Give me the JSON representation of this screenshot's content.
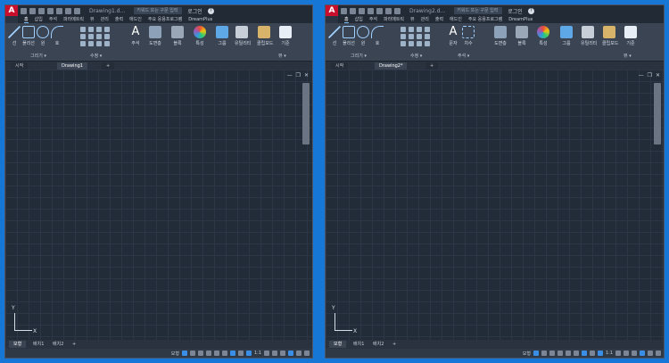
{
  "windows": [
    {
      "id": "left",
      "doc_title": "Drawing1.d...",
      "search_placeholder": "키워드 또는 구문 입력",
      "login": "로그인",
      "help": "?",
      "menu": [
        "홈",
        "삽입",
        "주석",
        "파라메트릭",
        "뷰",
        "관리",
        "출력",
        "애드인",
        "주요 응용프로그램",
        "DreamPlus"
      ],
      "ribbon_tools": [
        {
          "label": "선",
          "icon": "line-icon"
        },
        {
          "label": "폴리선",
          "icon": "polyline-icon"
        },
        {
          "label": "원",
          "icon": "circle-icon"
        },
        {
          "label": "호",
          "icon": "arc-icon"
        },
        {
          "label": "주석",
          "icon": "text-icon"
        },
        {
          "label": "도면층",
          "icon": "layers-icon"
        },
        {
          "label": "블록",
          "icon": "block-icon"
        },
        {
          "label": "특성",
          "icon": "properties-icon"
        },
        {
          "label": "그룹",
          "icon": "group-icon"
        },
        {
          "label": "유틸리티",
          "icon": "calculator-icon"
        },
        {
          "label": "클립보드",
          "icon": "clipboard-icon"
        },
        {
          "label": "기준",
          "icon": "base-icon"
        }
      ],
      "panel_labels": [
        "그리기 ▾",
        "수정 ▾",
        "뷰 ▾"
      ],
      "file_tabs": [
        "시작",
        "Drawing1",
        "+"
      ],
      "viewport_controls": "— ❐ ✕",
      "layout_tabs": [
        "모형",
        "배치1",
        "배치2",
        "+"
      ],
      "status_text": [
        "모형",
        "1:1"
      ]
    },
    {
      "id": "right",
      "doc_title": "Drawing2.d...",
      "search_placeholder": "키워드 또는 구문 입력",
      "login": "로그인",
      "help": "?",
      "menu": [
        "홈",
        "삽입",
        "주석",
        "파라메트릭",
        "뷰",
        "관리",
        "출력",
        "애드인",
        "주요 응용프로그램",
        "DreamPlus"
      ],
      "ribbon_tools": [
        {
          "label": "선",
          "icon": "line-icon"
        },
        {
          "label": "폴리선",
          "icon": "polyline-icon"
        },
        {
          "label": "원",
          "icon": "circle-icon"
        },
        {
          "label": "호",
          "icon": "arc-icon"
        },
        {
          "label": "문자",
          "icon": "text-icon"
        },
        {
          "label": "치수",
          "icon": "dimension-icon"
        },
        {
          "label": "도면층",
          "icon": "layers-icon"
        },
        {
          "label": "블록",
          "icon": "block-icon"
        },
        {
          "label": "특성",
          "icon": "properties-icon"
        },
        {
          "label": "그룹",
          "icon": "group-icon"
        },
        {
          "label": "유틸리티",
          "icon": "calculator-icon"
        },
        {
          "label": "클립보드",
          "icon": "clipboard-icon"
        },
        {
          "label": "기준",
          "icon": "base-icon"
        }
      ],
      "panel_labels": [
        "그리기 ▾",
        "수정 ▾",
        "주석 ▾",
        "뷰 ▾"
      ],
      "file_tabs": [
        "시작",
        "Drawing2*",
        "+"
      ],
      "viewport_controls": "— ❐ ✕",
      "layout_tabs": [
        "모형",
        "배치1",
        "배치2",
        "+"
      ],
      "status_text": [
        "모형",
        "1:1"
      ]
    }
  ],
  "colors": {
    "desktop": "#1677d6",
    "app_bg": "#2b3442",
    "canvas": "#222b38",
    "logo": "#c8102e",
    "accent": "#3a8ee6"
  }
}
